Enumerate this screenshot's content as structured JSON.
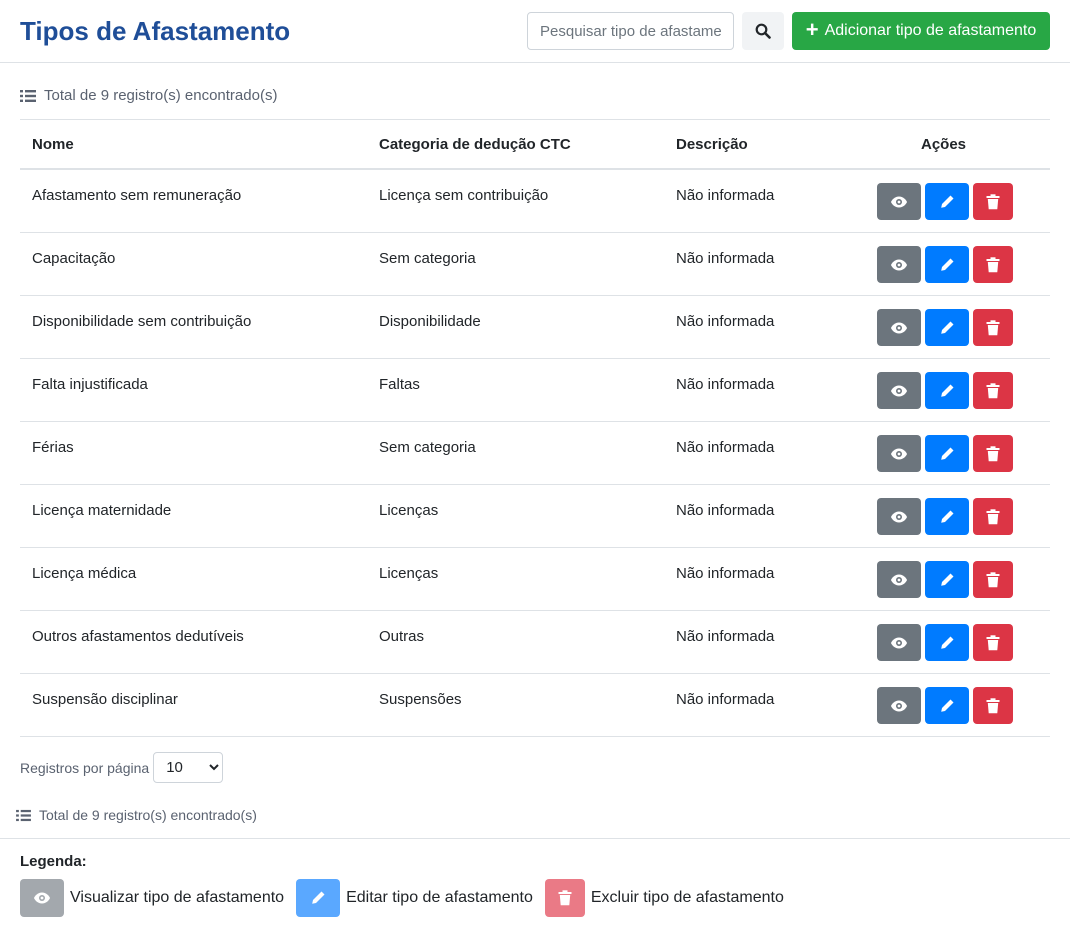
{
  "header": {
    "title": "Tipos de Afastamento",
    "search_placeholder": "Pesquisar tipo de afastamento",
    "search_icon": "search-icon",
    "add_label": "Adicionar tipo de afastamento",
    "add_icon": "plus-icon"
  },
  "summary": {
    "total_text": "Total de 9 registro(s) encontrado(s)",
    "list_icon": "list-icon"
  },
  "table": {
    "headers": {
      "name": "Nome",
      "category": "Categoria de dedução CTC",
      "description": "Descrição",
      "actions": "Ações"
    },
    "rows": [
      {
        "name": "Afastamento sem remuneração",
        "category": "Licença sem contribuição",
        "description": "Não informada"
      },
      {
        "name": "Capacitação",
        "category": "Sem categoria",
        "description": "Não informada"
      },
      {
        "name": "Disponibilidade sem contribuição",
        "category": "Disponibilidade",
        "description": "Não informada"
      },
      {
        "name": "Falta injustificada",
        "category": "Faltas",
        "description": "Não informada"
      },
      {
        "name": "Férias",
        "category": "Sem categoria",
        "description": "Não informada"
      },
      {
        "name": "Licença maternidade",
        "category": "Licenças",
        "description": "Não informada"
      },
      {
        "name": "Licença médica",
        "category": "Licenças",
        "description": "Não informada"
      },
      {
        "name": "Outros afastamentos dedutíveis",
        "category": "Outras",
        "description": "Não informada"
      },
      {
        "name": "Suspensão disciplinar",
        "category": "Suspensões",
        "description": "Não informada"
      }
    ],
    "action_icons": [
      "eye-icon",
      "pencil-icon",
      "trash-icon"
    ]
  },
  "pagination": {
    "per_page_label": "Registros por página",
    "per_page_value": "10",
    "per_page_options": [
      "10"
    ]
  },
  "legend": {
    "title": "Legenda:",
    "view_label": "Visualizar tipo de afastamento",
    "edit_label": "Editar tipo de afastamento",
    "delete_label": "Excluir tipo de afastamento"
  },
  "colors": {
    "title": "#1f4e98",
    "add_button": "#28a745",
    "view_button": "#6c757d",
    "edit_button": "#007bff",
    "delete_button": "#dc3545"
  }
}
